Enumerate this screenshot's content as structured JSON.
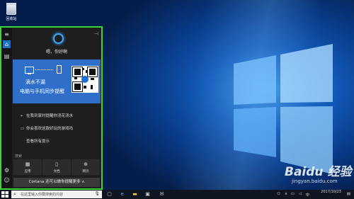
{
  "desktop": {
    "recycle_bin_label": "回收站"
  },
  "cortana": {
    "greeting": "嗯，你好啊",
    "card": {
      "line1": "滴水不漏",
      "line2": "电脑与手机同步提醒"
    },
    "items": [
      {
        "label": "在我到家时提醒你浇花浇水"
      },
      {
        "label": "你会喜欢这款好玩的游戏吗"
      },
      {
        "label": "查看所有提示"
      }
    ],
    "search_section": "搜索",
    "tiles": [
      {
        "label": "应用",
        "icon": "apps-icon"
      },
      {
        "label": "文档",
        "icon": "document-icon"
      },
      {
        "label": "网页",
        "icon": "web-icon"
      }
    ],
    "prompt": "Cortana 还可以做你提醒更多"
  },
  "taskbar": {
    "search_placeholder": "在这里输入你要搜索的内容",
    "time": "",
    "date": "2017/10/23",
    "language": "中"
  },
  "watermark": {
    "brand": "Baidu 经验",
    "url": "jingyan.baidu.com"
  },
  "colors": {
    "accent": "#2f6fc9",
    "highlight_border": "#39d63c",
    "panel_bg": "#1e1e1e"
  }
}
